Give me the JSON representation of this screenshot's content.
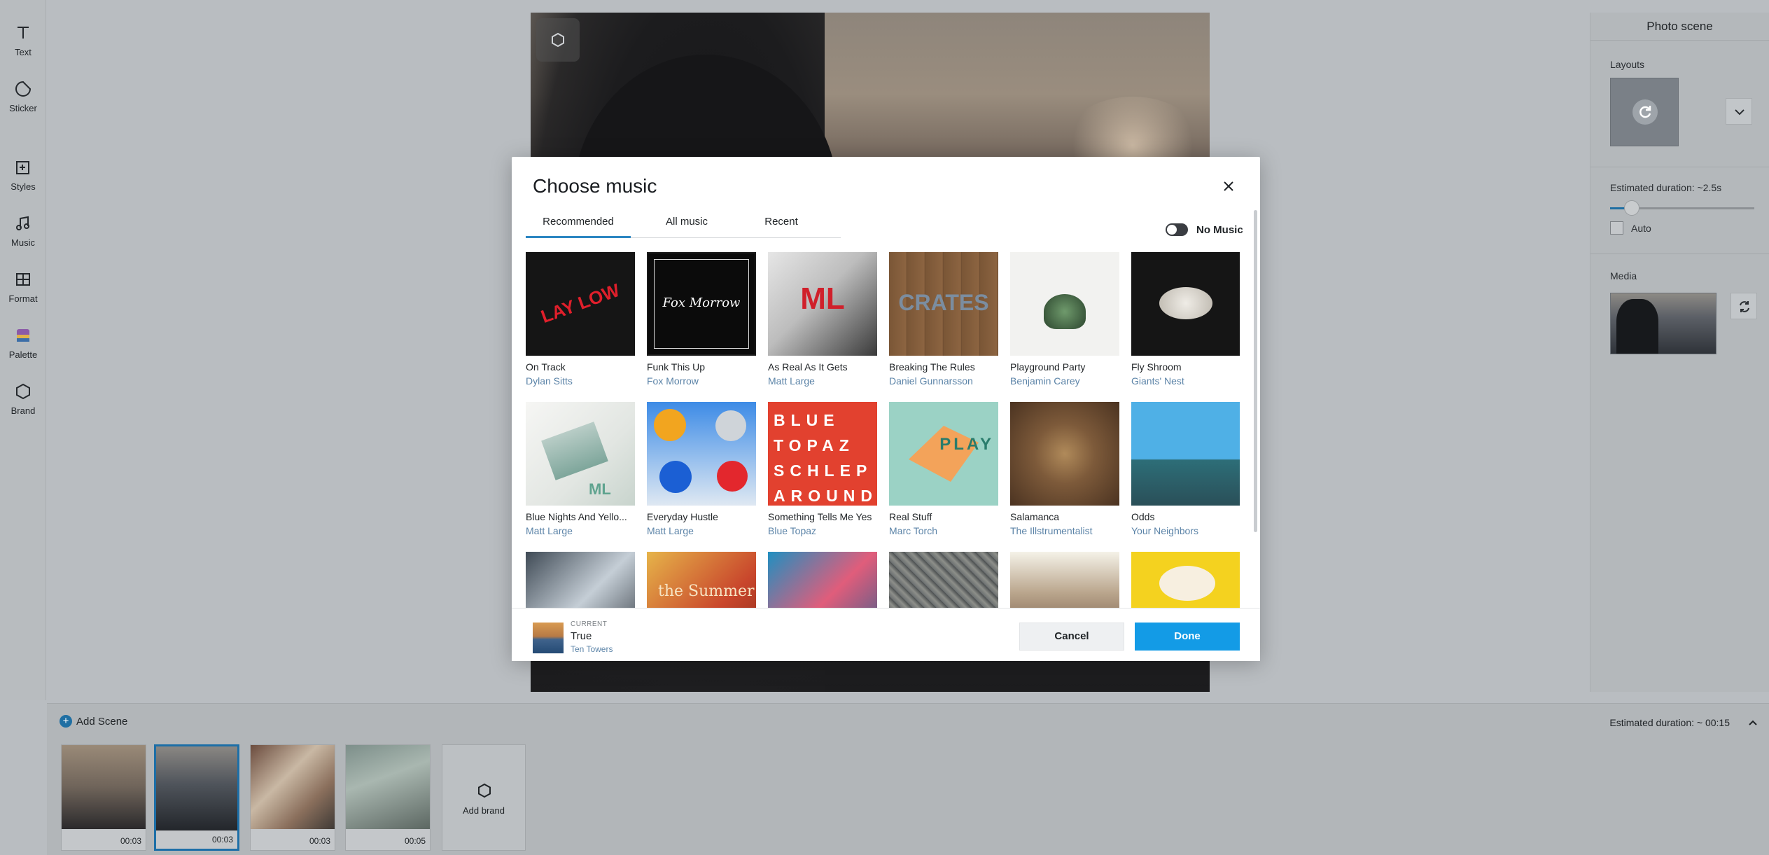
{
  "toolbar": {
    "items": [
      {
        "label": "Text",
        "icon": "text-icon"
      },
      {
        "label": "Sticker",
        "icon": "sticker-icon"
      },
      {
        "label": "Styles",
        "icon": "styles-icon"
      },
      {
        "label": "Music",
        "icon": "music-icon"
      },
      {
        "label": "Format",
        "icon": "format-icon"
      },
      {
        "label": "Palette",
        "icon": "palette-icon"
      },
      {
        "label": "Brand",
        "icon": "brand-icon"
      }
    ]
  },
  "right_panel": {
    "title": "Photo scene",
    "layouts_label": "Layouts",
    "estimated_duration": "Estimated duration: ~2.5s",
    "duration_slider_fraction": 0.15,
    "auto_label": "Auto",
    "media_label": "Media"
  },
  "timeline": {
    "add_scene_label": "Add Scene",
    "estimated_total": "Estimated duration: ~ 00:15",
    "scenes": [
      {
        "duration": "00:03"
      },
      {
        "duration": "00:03",
        "active": true
      },
      {
        "duration": "00:03"
      },
      {
        "duration": "00:05"
      }
    ],
    "add_brand_label": "Add brand"
  },
  "modal": {
    "title": "Choose music",
    "tabs": [
      "Recommended",
      "All music",
      "Recent"
    ],
    "active_tab": "Recommended",
    "no_music_label": "No Music",
    "tracks": [
      {
        "title": "On Track",
        "artist": "Dylan Sitts",
        "art_text": "LAY LOW"
      },
      {
        "title": "Funk This Up",
        "artist": "Fox Morrow",
        "art_text": "Fox Morrow"
      },
      {
        "title": "As Real As It Gets",
        "artist": "Matt Large",
        "art_text": "ML"
      },
      {
        "title": "Breaking The Rules",
        "artist": "Daniel Gunnarsson",
        "art_text": "CRATES"
      },
      {
        "title": "Playground Party",
        "artist": "Benjamin Carey",
        "art_text": ""
      },
      {
        "title": "Fly Shroom",
        "artist": "Giants' Nest",
        "art_text": ""
      },
      {
        "title": "Blue Nights And Yello...",
        "artist": "Matt Large",
        "art_text": "ML"
      },
      {
        "title": "Everyday Hustle",
        "artist": "Matt Large",
        "art_text": ""
      },
      {
        "title": "Something Tells Me Yes",
        "artist": "Blue Topaz",
        "art_text": "BLUE TOPAZ SCHLEP AROUND"
      },
      {
        "title": "Real Stuff",
        "artist": "Marc Torch",
        "art_text": "PLAY HOUSE"
      },
      {
        "title": "Salamanca",
        "artist": "The Illstrumentalist",
        "art_text": ""
      },
      {
        "title": "Odds",
        "artist": "Your Neighbors",
        "art_text": ""
      }
    ],
    "partial_row_art": [
      "",
      "the Summer",
      "",
      "",
      "",
      ""
    ],
    "current": {
      "label": "CURRENT",
      "title": "True",
      "artist": "Ten Towers"
    },
    "cancel_label": "Cancel",
    "done_label": "Done"
  },
  "colors": {
    "accent": "#139be6",
    "artist_link": "#5c84a8",
    "tab_underline": "#2d86c2"
  }
}
